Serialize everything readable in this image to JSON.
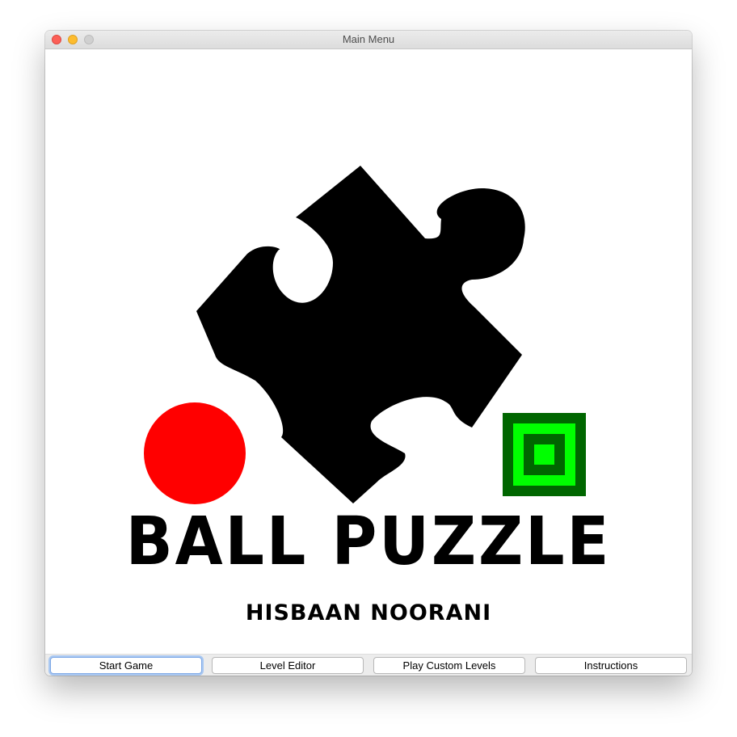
{
  "window": {
    "title": "Main Menu"
  },
  "logo": {
    "title": "BALL PUZZLE",
    "author": "HISBAAN NOORANI",
    "icons": {
      "puzzle": "puzzle-piece-icon",
      "ball": "ball-icon",
      "goal": "goal-square-icon"
    },
    "colors": {
      "puzzle": "#000000",
      "ball": "#ff0000",
      "goal_outer": "#006600",
      "goal_inner": "#00ff00"
    }
  },
  "buttons": {
    "start_game": "Start Game",
    "level_editor": "Level Editor",
    "play_custom_levels": "Play Custom Levels",
    "instructions": "Instructions"
  }
}
